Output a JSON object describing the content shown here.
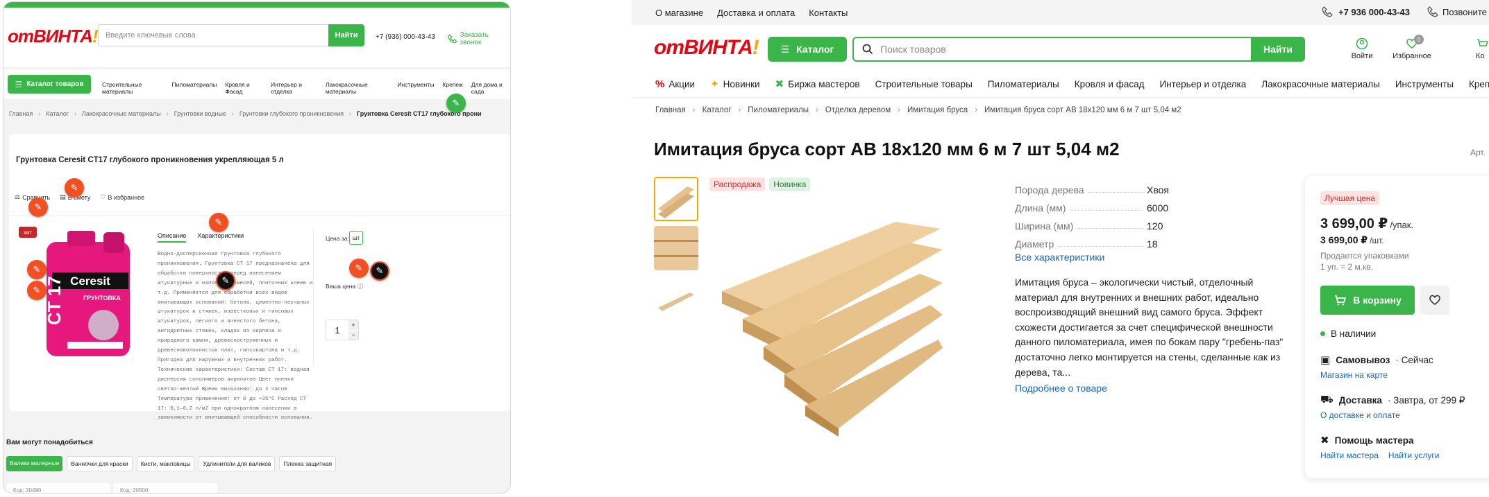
{
  "left": {
    "logo": {
      "o": "о",
      "t": "т",
      "main": "ВИНТА",
      "ex": "!"
    },
    "search": {
      "placeholder": "Введите ключевые слова",
      "button": "Найти"
    },
    "phone": "+7 (936) 000-43-43",
    "callback": "Заказать звонок",
    "catalog_button": "Каталог товаров",
    "nav": [
      "Строительные материалы",
      "Пиломатериалы",
      "Кровля и Фасад",
      "Интерьер и отделка",
      "Лакокрасочные материалы",
      "Инструменты",
      "Крепеж",
      "Для дома и сада"
    ],
    "breadcrumb": [
      "Главная",
      "Каталог",
      "Лакокрасочные материалы",
      "Грунтовки водные",
      "Грунтовки глубокого проникновения",
      "Грунтовка Ceresit CT17 глубокого прони"
    ],
    "product_title": "Грунтовка Ceresit CT17 глубокого проникновения укрепляющая 5 л",
    "actions": {
      "compare": "Сравнить",
      "list": "В смету",
      "favorite": "В избранное"
    },
    "badge_hit": "хит",
    "package_brand": "Ceresit",
    "package_model": "CT 17",
    "package_sub": "ГРУНТОВКА",
    "tabs": {
      "description": "Описание",
      "specs": "Характеристики"
    },
    "description_text": "Водно-дисперсионная грунтовка глубокого проникновения. Грунтовка CT 17 предназначена для обработки поверхностей перед нанесением штукатурных и напольных смесей, плиточных клеев и т.д. Применяется для обработки всех видов впитывающих оснований: бетона, цементно-песчаных штукатурок и стяжек, известковых и гипсовых штукатурок, легкого и ячеистого бетона, ангидритных стяжек, кладок из кирпича и природного камня, древесностружечных и древесноволокнистых плит, гипсокартона и т.д. Пригодна для наружных и внутренних работ. Технические характеристики: Состав CT 17: водная дисперсия сополимеров акрилатов Цвет пленки светло-желтый Время высыхания: до 2 часов Температура применения: от 0 до +35°С Расход CT 17: 0,1–0,2 л/м2 при однократном нанесении в зависимости от впитывающей способности основания.",
    "price_for": "Цена за:",
    "unit": "шт",
    "your_price": "Ваша цена",
    "qty": "1",
    "related_title": "Вам могут понадобиться",
    "related_tabs": [
      "Валики малярные",
      "Ванночки для краски",
      "Кисти, макловицы",
      "Удлинители для валиков",
      "Пленка защитная"
    ],
    "codes": [
      "Код: 20490",
      "Код: 20500"
    ]
  },
  "right": {
    "top_links": [
      "О магазине",
      "Доставка и оплата",
      "Контакты"
    ],
    "phone": "+7 936 000-43-43",
    "call": "Позвоните",
    "catalog_button": "Каталог",
    "search": {
      "placeholder": "Поиск товаров",
      "button": "Найти"
    },
    "header_icons": {
      "login": "Войти",
      "favorites": "Избранное",
      "fav_count": "0",
      "cart": "Ко"
    },
    "nav": [
      "Акции",
      "Новинки",
      "Биржа мастеров",
      "Строительные товары",
      "Пиломатериалы",
      "Кровля и фасад",
      "Интерьер и отделка",
      "Лакокрасочные материалы",
      "Инструменты",
      "Крепеж"
    ],
    "breadcrumb": [
      "Главная",
      "Каталог",
      "Пиломатериалы",
      "Отделка деревом",
      "Имитация бруса",
      "Имитация бруса сорт АВ 18х120 мм 6 м 7 шт 5,04 м2"
    ],
    "title": "Имитация бруса сорт АВ 18х120 мм 6 м 7 шт 5,04 м2",
    "article": "Арт.",
    "tags": [
      "Распродажа",
      "Новинка"
    ],
    "specs": [
      {
        "label": "Порода дерева",
        "value": "Хвоя"
      },
      {
        "label": "Длина (мм)",
        "value": "6000"
      },
      {
        "label": "Ширина (мм)",
        "value": "120"
      },
      {
        "label": "Диаметр",
        "value": "18"
      }
    ],
    "all_specs": "Все характеристики",
    "description": "Имитация бруса – экологически чистый, отделочный материал для внутренних и внешних работ, идеально воспроизводящий внешний вид самого бруса. Эффект схожести достигается за счет специфической внешности данного пиломатериала, имея по бокам пару \"гребень-паз\" достаточно легко монтируется на стены, сделанные как из дерева, та...",
    "more_link": "Подробнее о товаре",
    "price": {
      "best": "Лучшая цена",
      "pack_price": "3 699,00 ₽",
      "pack_unit": "/упак.",
      "item_price": "3 699,00 ₽",
      "item_unit": "/шт.",
      "note1": "Продается упаковками",
      "note2": "1 уп. = 2 м.кв.",
      "cart_button": "В корзину",
      "stock": "В наличии",
      "pickup": "Самовывоз",
      "pickup_when": "· Сейчас",
      "pickup_link": "Магазин на карте",
      "delivery": "Доставка",
      "delivery_when": "· Завтра, от 299 ₽",
      "delivery_link": "О доставке и оплате",
      "help": "Помощь мастера",
      "help_link1": "Найти мастера",
      "help_link2": "Найти услуги"
    }
  },
  "colors": {
    "green": "#39b54a",
    "red": "#e30613",
    "orange": "#f7a600",
    "link": "#1565c0",
    "sale_bg": "#fde2e2",
    "new_bg": "#dff3e2"
  }
}
